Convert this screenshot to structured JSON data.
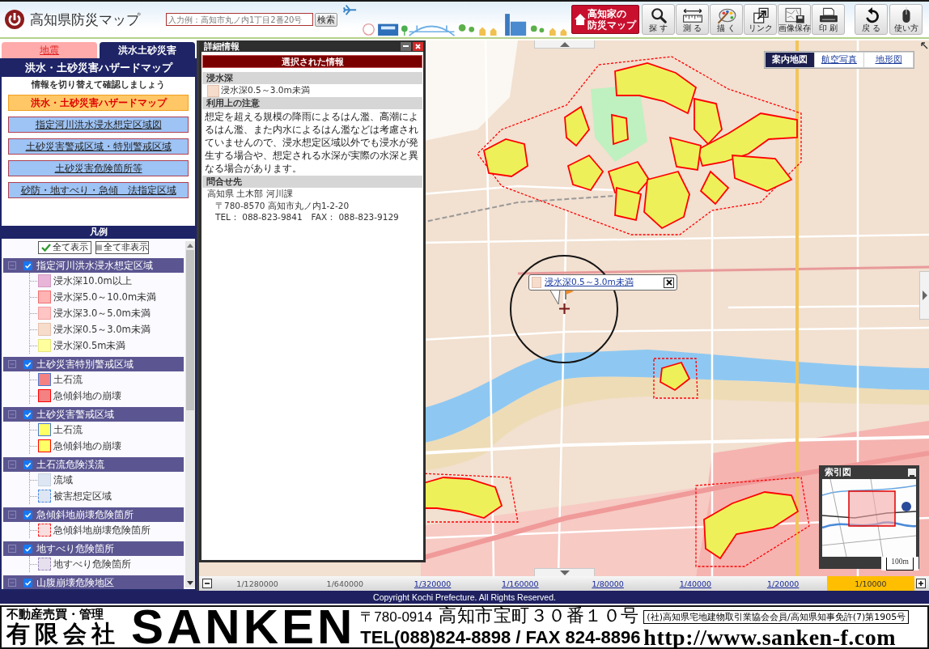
{
  "header": {
    "title": "高知県防災マップ",
    "search": {
      "placeholder": "入力例：高知市丸ノ内1丁目2番20号",
      "button": "検索"
    },
    "home_button": {
      "lines": [
        "高知家の",
        "防災マップ"
      ]
    },
    "tools": [
      {
        "kind": "search",
        "label": "探 す"
      },
      {
        "kind": "measure",
        "label": "測 る"
      },
      {
        "kind": "draw",
        "label": "描 く"
      },
      {
        "kind": "link",
        "label": "リンク"
      },
      {
        "kind": "save_image",
        "label": "画像保存"
      },
      {
        "kind": "print",
        "label": "印 刷"
      }
    ],
    "nav": [
      {
        "kind": "back",
        "label": "戻 る"
      },
      {
        "kind": "help",
        "label": "使い方"
      }
    ]
  },
  "sidebar": {
    "tabs": [
      {
        "label": "地震",
        "selected": false
      },
      {
        "label": "洪水土砂災害",
        "selected": true
      }
    ],
    "title": "洪水・土砂災害ハザードマップ",
    "subtitle": "情報を切り替えて確認しましょう",
    "layers": [
      {
        "label": "洪水・土砂災害ハザードマップ",
        "selected": true
      },
      {
        "label": "指定河川洪水浸水想定区域図",
        "selected": false
      },
      {
        "label": "土砂災害警戒区域・特別警戒区域",
        "selected": false
      },
      {
        "label": "土砂災害危険箇所等",
        "selected": false
      },
      {
        "label": "砂防・地すべり・急傾　法指定区域",
        "selected": false
      }
    ],
    "legend": {
      "title": "凡例",
      "show_all": "全て表示",
      "hide_all": "全て非表示",
      "groups": [
        {
          "label": "指定河川洪水浸水想定区域",
          "checked": true,
          "expanded": true,
          "children": [
            {
              "label": "浸水深10.0m以上",
              "color": "#e8b4d8",
              "border": {
                "color": "#d49ac2",
                "dashed": false
              }
            },
            {
              "label": "浸水深5.0～10.0m未満",
              "color": "#ffb3b3",
              "border": {
                "color": "#f07070",
                "dashed": false
              }
            },
            {
              "label": "浸水深3.0～5.0m未満",
              "color": "#ffc4c4",
              "border": {
                "color": "#f5a0a0",
                "dashed": false
              }
            },
            {
              "label": "浸水深0.5～3.0m未満",
              "color": "#f5dccb",
              "border": {
                "color": "#e6c2ae",
                "dashed": false
              }
            },
            {
              "label": "浸水深0.5m未満",
              "color": "#ffff9e",
              "border": {
                "color": "#e6e680",
                "dashed": false
              }
            }
          ]
        },
        {
          "label": "土砂災害特別警戒区域",
          "checked": true,
          "expanded": true,
          "children": [
            {
              "label": "土石流",
              "color": "#f58282",
              "border": {
                "color": "#4a7ad0",
                "dashed": false
              }
            },
            {
              "label": "急傾斜地の崩壊",
              "color": "#f58282",
              "border": {
                "color": "#ff0000",
                "dashed": false
              }
            }
          ]
        },
        {
          "label": "土砂災害警戒区域",
          "checked": true,
          "expanded": true,
          "children": [
            {
              "label": "土石流",
              "color": "#ffff66",
              "border": {
                "color": "#4a7ad0",
                "dashed": false
              }
            },
            {
              "label": "急傾斜地の崩壊",
              "color": "#ffff66",
              "border": {
                "color": "#ff0000",
                "dashed": false
              }
            }
          ]
        },
        {
          "label": "土石流危険渓流",
          "checked": true,
          "expanded": true,
          "children": [
            {
              "label": "流域",
              "color": "#dde6f2",
              "border": {
                "color": "#c8d4e4",
                "dashed": false
              }
            },
            {
              "label": "被害想定区域",
              "color": "#dde6f2",
              "border": {
                "color": "#4a8ae0",
                "dashed": true
              }
            }
          ]
        },
        {
          "label": "急傾斜地崩壊危険箇所",
          "checked": true,
          "expanded": true,
          "children": [
            {
              "label": "急傾斜地崩壊危険箇所",
              "color": "#f8dede",
              "border": {
                "color": "#ff2020",
                "dashed": true
              }
            }
          ]
        },
        {
          "label": "地すべり危険箇所",
          "checked": true,
          "expanded": true,
          "children": [
            {
              "label": "地すべり危険箇所",
              "color": "#e6e0ee",
              "border": {
                "color": "#9a88b8",
                "dashed": true
              }
            }
          ]
        },
        {
          "label": "山腹崩壊危険地区",
          "checked": true,
          "expanded": true
        }
      ]
    }
  },
  "detail": {
    "title": "詳細情報",
    "heading": "選択された情報",
    "sections": [
      {
        "kind": "swatch",
        "title": "浸水深",
        "color": "#f5dccb",
        "text": "浸水深0.5～3.0m未満"
      },
      {
        "kind": "paragraph",
        "title": "利用上の注意",
        "text": "想定を超える規模の降雨によるはん濫、高潮によるはん濫、また内水によるはん濫などは考慮されていませんので、浸水想定区域以外でも浸水が発生する場合や、想定される水深が実際の水深と異なる場合があります。"
      },
      {
        "kind": "contact",
        "title": "問合せ先",
        "organization": "高知県 土木部 河川課",
        "lines": [
          "〒780-8570 高知市丸ノ内1-2-20",
          "TEL： 088-823-9841　FAX： 088-823-9129"
        ]
      }
    ]
  },
  "map": {
    "types": [
      {
        "label": "案内地図",
        "selected": true
      },
      {
        "label": "航空写真",
        "selected": false
      },
      {
        "label": "地形図",
        "selected": false
      }
    ],
    "popup": {
      "color": "#f5dccb",
      "text": "浸水深0.5～3.0m未満"
    },
    "overview": {
      "title": "索引図"
    },
    "scale_indicator": "100m",
    "zoom_levels": [
      {
        "label": "1/1280000",
        "selected": false,
        "disabled": true
      },
      {
        "label": "1/640000",
        "selected": false,
        "disabled": true
      },
      {
        "label": "1/320000",
        "selected": false,
        "disabled": false
      },
      {
        "label": "1/160000",
        "selected": false,
        "disabled": false
      },
      {
        "label": "1/80000",
        "selected": false,
        "disabled": false
      },
      {
        "label": "1/40000",
        "selected": false,
        "disabled": false
      },
      {
        "label": "1/20000",
        "selected": false,
        "disabled": false
      },
      {
        "label": "1/10000",
        "selected": true,
        "disabled": false
      }
    ]
  },
  "copyright": "Copyright Kochi Prefecture. All Rights Reserved.",
  "banner": {
    "tagline": "不動産売買・管理",
    "company_type": "有限会社",
    "brand": "SANKEN",
    "postal_code": "〒780-0914",
    "address": "高知市宝町３０番１０号",
    "license": "(社)高知県宅地建物取引業協会会員/高知県知事免許(7)第1905号",
    "phone": "TEL(088)824-8898 / FAX 824-8896",
    "url": "http://www.sanken-f.com"
  }
}
